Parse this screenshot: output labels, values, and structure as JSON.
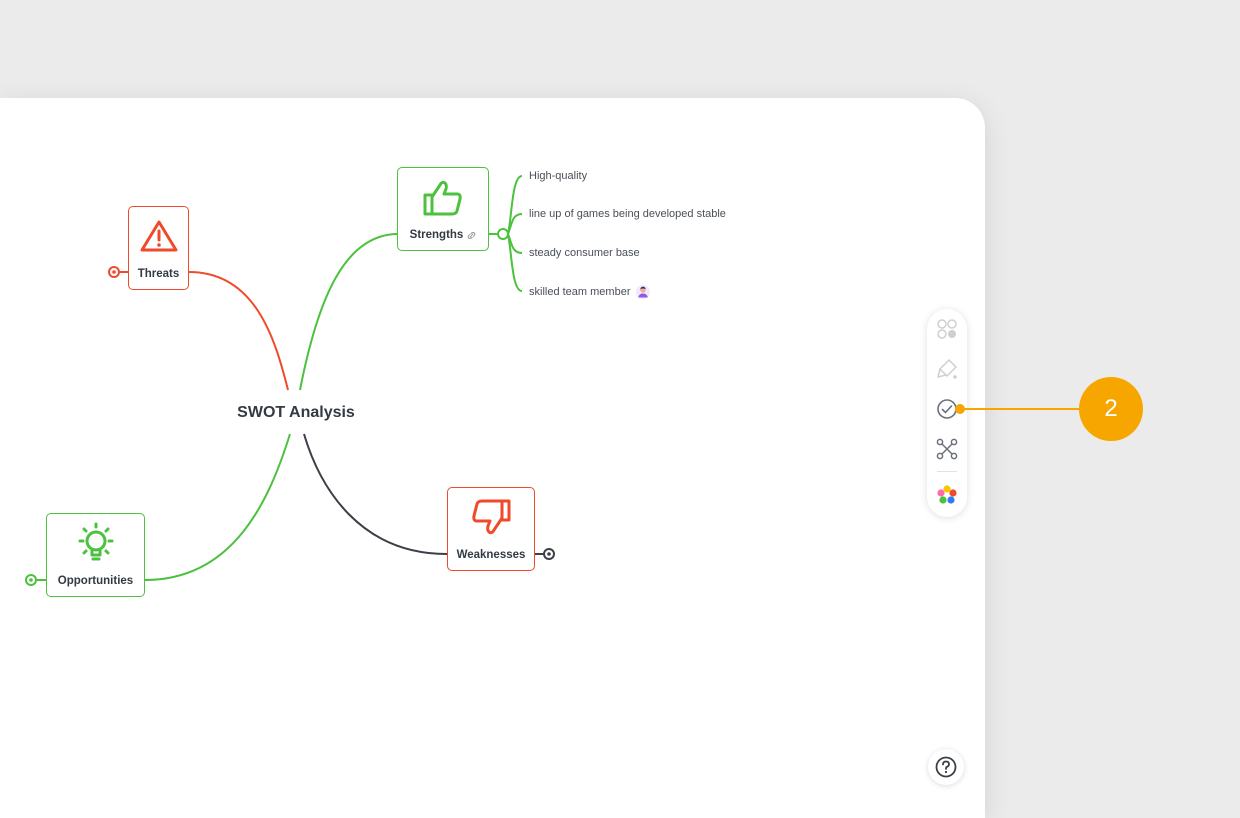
{
  "mindmap": {
    "central_topic": "SWOT Analysis",
    "strengths": {
      "label": "Strengths",
      "icon": "thumbs-up-icon",
      "attachment_icon": "link-icon",
      "color": "#4cc13e",
      "items": [
        "High-quality",
        "line up of games being developed stable",
        "steady consumer base",
        "skilled team member"
      ]
    },
    "threats": {
      "label": "Threats",
      "icon": "warning-icon",
      "color": "#ef4a2a"
    },
    "opportunities": {
      "label": "Opportunities",
      "icon": "lightbulb-icon",
      "color": "#4cc13e"
    },
    "weaknesses": {
      "label": "Weaknesses",
      "icon": "thumbs-down-icon",
      "color": "#ef4a2a"
    },
    "central_branch_color": "#3a3f48"
  },
  "toolbar": {
    "items": [
      "style-icon",
      "format-paint-icon",
      "task-check-icon",
      "structure-icon",
      "color-theme-icon"
    ]
  },
  "help": {
    "icon": "help-icon"
  },
  "callout": {
    "number": "2",
    "color": "#f7a600"
  }
}
